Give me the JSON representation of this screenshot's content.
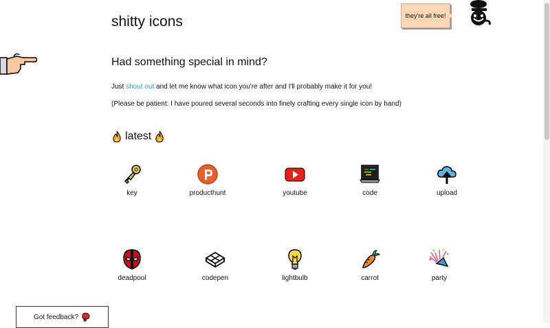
{
  "header": {
    "title": "shitty icons"
  },
  "bubble": {
    "text": "they're all free!"
  },
  "request": {
    "heading": "Had something special in mind?",
    "text_before": "Just ",
    "link_text": "shout out",
    "text_after": " and let me know what icon you're after and I'll probably make it for you!",
    "note": "(Please be patient: I have poured several seconds into finely crafting every single icon by hand)"
  },
  "latest": {
    "label": "latest",
    "icon": "fire-icon"
  },
  "icons": [
    {
      "label": "key",
      "icon": "key-icon"
    },
    {
      "label": "producthunt",
      "icon": "producthunt-icon"
    },
    {
      "label": "youtube",
      "icon": "youtube-icon"
    },
    {
      "label": "code",
      "icon": "code-icon"
    },
    {
      "label": "upload",
      "icon": "upload-icon"
    },
    {
      "label": "deadpool",
      "icon": "deadpool-icon"
    },
    {
      "label": "codepen",
      "icon": "codepen-icon"
    },
    {
      "label": "lightbulb",
      "icon": "lightbulb-icon"
    },
    {
      "label": "carrot",
      "icon": "carrot-icon"
    },
    {
      "label": "party",
      "icon": "party-icon"
    }
  ],
  "feedback": {
    "label": "Got feedback?",
    "icon": "boxing-glove-icon"
  },
  "colors": {
    "link": "#2a9fd6",
    "bubble": "#fcd7b6"
  }
}
